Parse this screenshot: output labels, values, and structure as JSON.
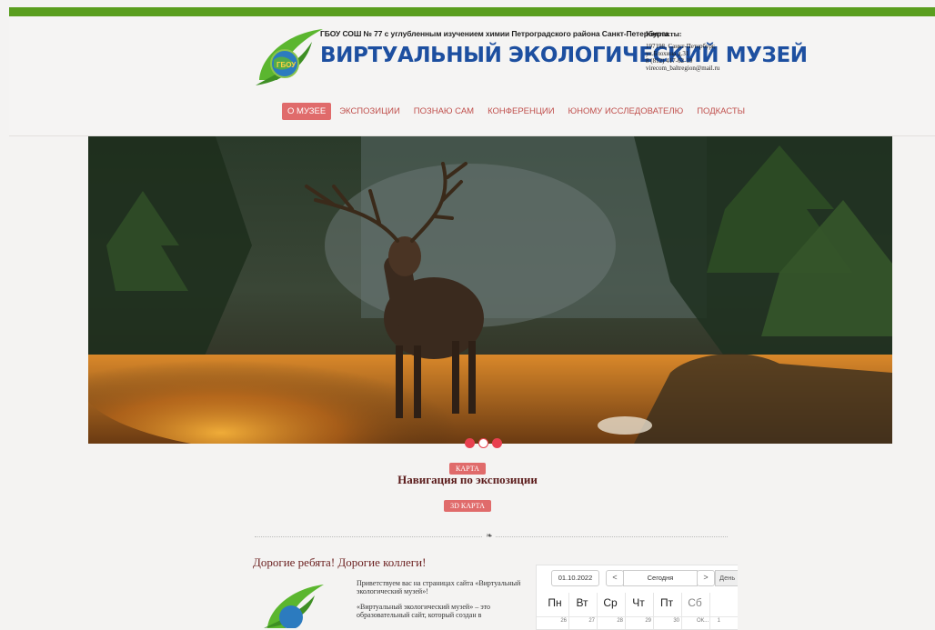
{
  "header": {
    "school_name": "ГБОУ СОШ № 77 с углубленным изучением химии Петроградского района Санкт-Петербурга",
    "museum_title": "ВИРТУАЛЬНЫЙ ЭКОЛОГИЧЕСКИЙ МУЗЕЙ",
    "logo_text": "ГБОУ",
    "contacts_heading": "Контакты:",
    "contacts_lines": [
      "197198, Санкт-Петербург,",
      "ул.Блохина д.31",
      "8 (812) 417-62-19",
      "virecom_baltregion@mail.ru"
    ]
  },
  "nav": {
    "items": [
      {
        "label": "О МУЗЕЕ",
        "active": true
      },
      {
        "label": "ЭКСПОЗИЦИИ"
      },
      {
        "label": "ПОЗНАЮ САМ"
      },
      {
        "label": "КОНФЕРЕНЦИИ"
      },
      {
        "label": "ЮНОМУ ИССЛЕДОВАТЕЛЮ"
      },
      {
        "label": "ПОДКАСТЫ"
      }
    ]
  },
  "slider": {
    "total": 3,
    "active_index": 1
  },
  "navigation": {
    "map_button": "КАРТА",
    "title": "Навигация по экспозиции",
    "map3d_button": "3D КАРТА"
  },
  "welcome": {
    "heading": "Дорогие ребята! Дорогие коллеги!",
    "paragraph1": "Приветствуем вас на страницах сайта «Виртуальный экологический музей»!",
    "paragraph2": "«Виртуальный экологический музей» – это образовательный сайт, который создан в"
  },
  "calendar": {
    "date_value": "01.10.2022",
    "prev_label": "<",
    "today_label": "Сегодня",
    "next_label": ">",
    "view_label": "День",
    "weekdays": [
      "Пн",
      "Вт",
      "Ср",
      "Чт",
      "Пт",
      "Сб"
    ],
    "first_row_days": [
      "26",
      "27",
      "28",
      "29",
      "30",
      "1"
    ],
    "event_snippet": "ОК..."
  },
  "colors": {
    "topbar": "#5a9e1f",
    "accent": "#e06b6b",
    "title_blue": "#1d4fa0",
    "dot": "#e8404f"
  }
}
